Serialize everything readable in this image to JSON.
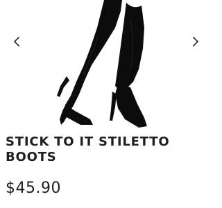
{
  "product": {
    "title": "STICK TO IT STILETTO BOOTS",
    "price": "$45.90",
    "image_icon": "black-stiletto-knee-boots"
  },
  "carousel": {
    "prev_icon": "chevron-left-icon",
    "next_icon": "chevron-right-icon"
  },
  "colors": {
    "text": "#1f1f1f",
    "boot": "#0c0c0c",
    "chevron": "#333333"
  }
}
